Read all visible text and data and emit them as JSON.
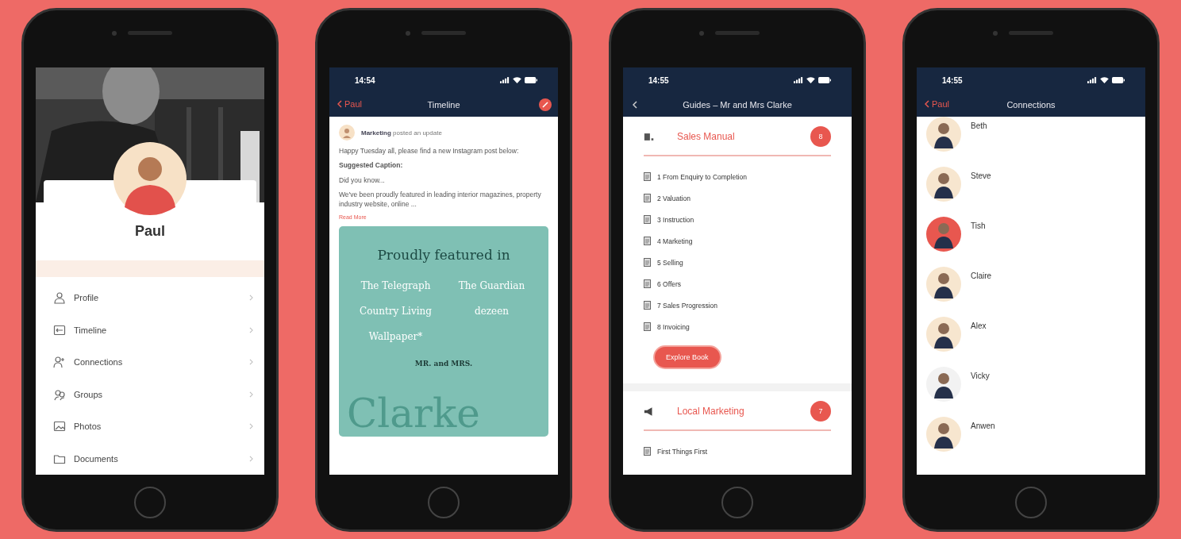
{
  "phones": [
    {
      "kind": "profile",
      "name": "Paul",
      "menu": [
        {
          "label": "Profile"
        },
        {
          "label": "Timeline"
        },
        {
          "label": "Connections"
        },
        {
          "label": "Groups"
        },
        {
          "label": "Photos"
        },
        {
          "label": "Documents"
        }
      ]
    },
    {
      "kind": "timeline",
      "time": "14:54",
      "back": "Paul",
      "title": "Timeline",
      "post": {
        "author": "Marketing",
        "action": "posted an update",
        "paragraphs": [
          "Happy Tuesday all, please find a new Instagram post below:",
          "**Suggested Caption:**",
          "Did you know...",
          "We've been proudly featured in leading interior magazines, property industry website, online ..."
        ],
        "more": "Read More",
        "graphic": {
          "heading": "Proudly featured in",
          "logos": [
            "The Telegraph",
            "The Guardian",
            "Country Living",
            "dezeen",
            "Wallpaper*"
          ],
          "brand": "MR. and MRS.",
          "backdrop": "Clarke"
        }
      }
    },
    {
      "kind": "guides",
      "time": "14:55",
      "title": "Guides – Mr and Mrs Clarke",
      "sections": [
        {
          "title": "Sales Manual",
          "count": "8",
          "items": [
            "1 From Enquiry to Completion",
            "2 Valuation",
            "3 Instruction",
            "4 Marketing",
            "5 Selling",
            "6 Offers",
            "7 Sales Progression",
            "8 Invoicing"
          ],
          "button": "Explore Book"
        },
        {
          "title": "Local Marketing",
          "count": "7",
          "items": [
            "First Things First"
          ]
        }
      ]
    },
    {
      "kind": "connections",
      "time": "14:55",
      "back": "Paul",
      "title": "Connections",
      "people": [
        {
          "name": "Beth",
          "color": "#f7e6cf"
        },
        {
          "name": "Steve",
          "color": "#f7e6cf"
        },
        {
          "name": "Tish",
          "color": "#e8574f"
        },
        {
          "name": "Claire",
          "color": "#f7e6cf"
        },
        {
          "name": "Alex",
          "color": "#f7e6cf"
        },
        {
          "name": "Vicky",
          "color": "#f2f2f2"
        },
        {
          "name": "Anwen",
          "color": "#f7e6cf"
        }
      ]
    }
  ]
}
